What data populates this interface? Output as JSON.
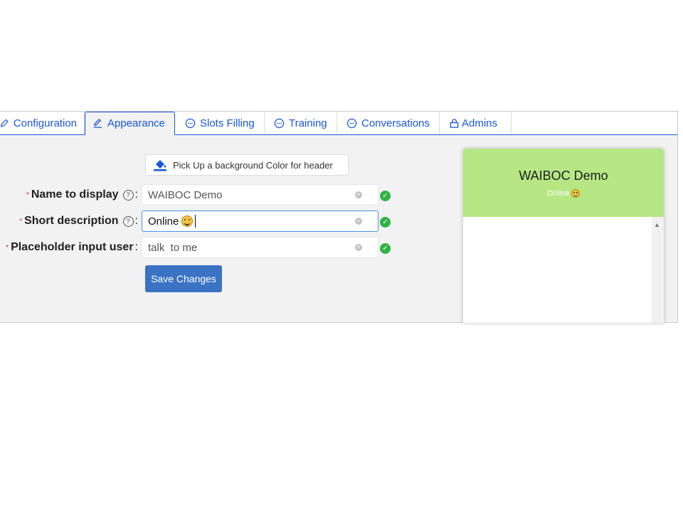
{
  "tabs": [
    {
      "label": "Configuration",
      "icon": "pencil-icon"
    },
    {
      "label": "Appearance",
      "icon": "pencil-icon"
    },
    {
      "label": "Slots Filling",
      "icon": "chat-bubble-icon"
    },
    {
      "label": "Training",
      "icon": "chat-bubble-icon"
    },
    {
      "label": "Conversations",
      "icon": "chat-bubble-icon"
    },
    {
      "label": "Admins",
      "icon": "lock-icon"
    }
  ],
  "active_tab": "Appearance",
  "form": {
    "pick_color_label": "Pick Up a background Color for header",
    "fields": [
      {
        "label": "Name to display",
        "value": "WAIBOC Demo",
        "has_help": true
      },
      {
        "label": "Short description",
        "value": "Online",
        "has_help": true
      },
      {
        "label": "Placeholder input user",
        "value": "talk  to me",
        "has_help": false
      }
    ],
    "save_label": "Save Changes"
  },
  "preview": {
    "title": "WAIBOC Demo",
    "subtitle": "Online",
    "header_color": "#b6e784"
  },
  "colors": {
    "accent": "#1a56db",
    "save": "#3b73c4",
    "valid": "#2fb344"
  }
}
